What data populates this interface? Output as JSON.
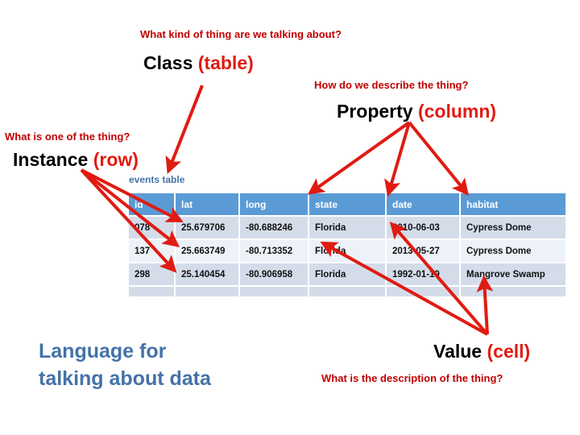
{
  "slide": {
    "title_bottom_left": "Language for\ntalking about data",
    "background": "#ffffff",
    "accent_red": "#E01B12",
    "accent_dark_red": "#C00000",
    "accent_blue": "#4472A8",
    "header_blue": "#5B9BD5"
  },
  "annotations": {
    "class": {
      "question": "What kind of thing are we talking about?",
      "term": "Class",
      "paren": "(table)"
    },
    "property": {
      "question": "How do we describe the thing?",
      "term": "Property",
      "paren": "(column)"
    },
    "instance": {
      "question": "What is one of the thing?",
      "term": "Instance",
      "paren": "(row)"
    },
    "value": {
      "question": "What is the description of the thing?",
      "term": "Value",
      "paren": "(cell)"
    }
  },
  "bottom_title": {
    "line1": "Language for",
    "line2": "talking about data"
  },
  "table": {
    "caption": "events table",
    "columns": [
      "id",
      "lat",
      "long",
      "state",
      "date",
      "habitat"
    ],
    "rows": [
      [
        "078",
        "25.679706",
        "-80.688246",
        "Florida",
        "2010-06-03",
        "Cypress Dome"
      ],
      [
        "137",
        "25.663749",
        "-80.713352",
        "Florida",
        "2013-05-27",
        "Cypress Dome"
      ],
      [
        "298",
        "25.140454",
        "-80.906958",
        "Florida",
        "1992-01-19",
        "Mangrove Swamp"
      ]
    ]
  }
}
